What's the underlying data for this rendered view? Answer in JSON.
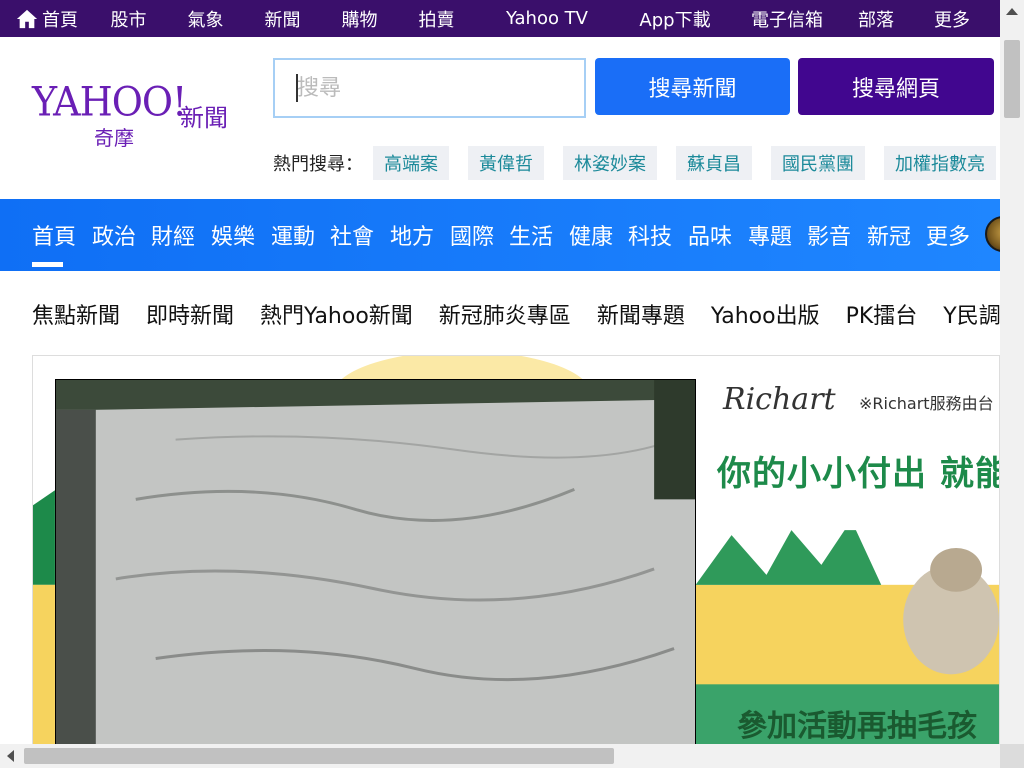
{
  "colors": {
    "topbar": "#3a0f6b",
    "brand_purple": "#6a1fb5",
    "blue_nav": "#1a7bff",
    "news_button": "#1a6ef7",
    "web_button": "#41068f",
    "trending_text": "#1c8a9a",
    "ad_green": "#1d8a4a",
    "ad_yellow": "#f6d35e"
  },
  "topbar": {
    "home_icon": "home-icon",
    "items": [
      "首頁",
      "股市",
      "氣象",
      "新聞",
      "購物",
      "拍賣",
      "Yahoo TV",
      "App下載",
      "電子信箱",
      "部落",
      "更多"
    ]
  },
  "logo": {
    "wordmark": "YAHOO!",
    "sub": "奇摩",
    "section": "新聞"
  },
  "search": {
    "placeholder": "搜尋",
    "news_button": "搜尋新聞",
    "web_button": "搜尋網頁"
  },
  "trending": {
    "label": "熱門搜尋：",
    "tags": [
      "高端案",
      "黃偉哲",
      "林姿妙案",
      "蘇貞昌",
      "國民黨團",
      "加權指數亮"
    ]
  },
  "bluenav": {
    "items": [
      "首頁",
      "政治",
      "財經",
      "娛樂",
      "運動",
      "社會",
      "地方",
      "國際",
      "生活",
      "健康",
      "科技",
      "品味",
      "專題",
      "影音",
      "新冠",
      "更多"
    ],
    "active_index": 0,
    "avatar": "user-avatar"
  },
  "subnav": {
    "items": [
      "焦點新聞",
      "即時新聞",
      "熱門Yahoo新聞",
      "新冠肺炎專區",
      "新聞專題",
      "Yahoo出版",
      "PK擂台",
      "Y民調"
    ],
    "more_icon": "more-icon",
    "more_glyph": "•••"
  },
  "ad": {
    "brand": "Richart",
    "note": "※Richart服務由台",
    "headline": "你的小小付出 就能",
    "promo": "參加活動再抽毛孩"
  }
}
